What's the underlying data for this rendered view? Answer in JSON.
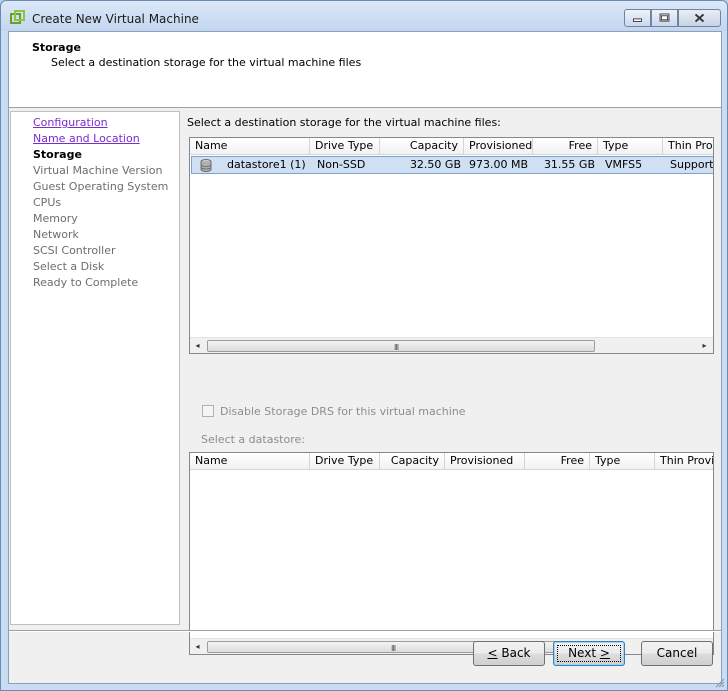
{
  "window": {
    "title": "Create New Virtual Machine"
  },
  "header": {
    "title": "Storage",
    "subtitle": "Select a destination storage for the virtual machine files"
  },
  "nav": {
    "items": [
      {
        "label": "Configuration",
        "state": "visited"
      },
      {
        "label": "Name and Location",
        "state": "visited"
      },
      {
        "label": "Storage",
        "state": "current"
      },
      {
        "label": "Virtual Machine Version",
        "state": "pending"
      },
      {
        "label": "Guest Operating System",
        "state": "pending"
      },
      {
        "label": "CPUs",
        "state": "pending"
      },
      {
        "label": "Memory",
        "state": "pending"
      },
      {
        "label": "Network",
        "state": "pending"
      },
      {
        "label": "SCSI Controller",
        "state": "pending"
      },
      {
        "label": "Select a Disk",
        "state": "pending"
      },
      {
        "label": "Ready to Complete",
        "state": "pending"
      }
    ]
  },
  "main": {
    "label": "Select a destination storage for the virtual machine files:",
    "storage_table": {
      "columns": [
        "Name",
        "Drive Type",
        "Capacity",
        "Provisioned",
        "Free",
        "Type",
        "Thin Prov"
      ],
      "rows": [
        {
          "name": "datastore1 (1)",
          "drive_type": "Non-SSD",
          "capacity": "32.50 GB",
          "provisioned": "973.00 MB",
          "free": "31.55 GB",
          "type": "VMFS5",
          "thin": "Supporte"
        }
      ]
    },
    "disable_drs_label": "Disable Storage DRS for this virtual machine",
    "select_datastore_label": "Select a datastore:",
    "datastore_table": {
      "columns": [
        "Name",
        "Drive Type",
        "Capacity",
        "Provisioned",
        "Free",
        "Type",
        "Thin Provi"
      ]
    },
    "scroll_grip": "III"
  },
  "buttons": {
    "back_mnemonic": "<",
    "back_rest": " Back",
    "next_label": "Next ",
    "next_mnemonic": ">",
    "cancel": "Cancel"
  },
  "colors": {
    "visited_link": "#7a2bd4",
    "selection": "#cfe0f3",
    "disabled_text": "#8d8d8d"
  }
}
